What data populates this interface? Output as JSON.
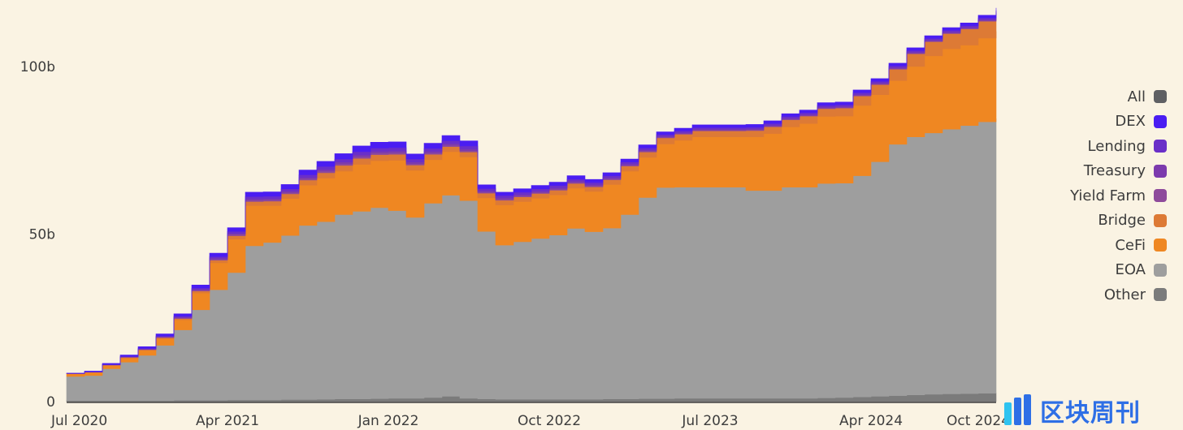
{
  "chart_data": {
    "type": "area",
    "stacked": true,
    "title": "",
    "xlabel": "",
    "ylabel": "",
    "ylim": [
      0,
      115
    ],
    "y_unit": "b",
    "y_ticks": [
      {
        "value": 0,
        "label": "0"
      },
      {
        "value": 50,
        "label": "50b"
      },
      {
        "value": 100,
        "label": "100b"
      }
    ],
    "x_ticks": [
      "Jul 2020",
      "Apr 2021",
      "Jan 2022",
      "Oct 2022",
      "Jul 2023",
      "Apr 2024",
      "Oct 2024"
    ],
    "x": [
      "2020-07",
      "2020-08",
      "2020-09",
      "2020-10",
      "2020-11",
      "2020-12",
      "2021-01",
      "2021-02",
      "2021-03",
      "2021-04",
      "2021-05",
      "2021-06",
      "2021-07",
      "2021-08",
      "2021-09",
      "2021-10",
      "2021-11",
      "2021-12",
      "2022-01",
      "2022-02",
      "2022-03",
      "2022-04",
      "2022-05",
      "2022-06",
      "2022-07",
      "2022-08",
      "2022-09",
      "2022-10",
      "2022-11",
      "2022-12",
      "2023-01",
      "2023-02",
      "2023-03",
      "2023-04",
      "2023-05",
      "2023-06",
      "2023-07",
      "2023-08",
      "2023-09",
      "2023-10",
      "2023-11",
      "2023-12",
      "2024-01",
      "2024-02",
      "2024-03",
      "2024-04",
      "2024-05",
      "2024-06",
      "2024-07",
      "2024-08",
      "2024-09",
      "2024-10",
      "2024-11"
    ],
    "legend_position": "right",
    "series": [
      {
        "name": "Other",
        "color": "#7b7b7b",
        "values": [
          0.3,
          0.3,
          0.3,
          0.3,
          0.3,
          0.3,
          0.4,
          0.4,
          0.4,
          0.5,
          0.5,
          0.5,
          0.6,
          0.6,
          0.7,
          0.8,
          0.8,
          0.9,
          1.0,
          1.0,
          1.2,
          1.6,
          1.0,
          0.8,
          0.7,
          0.7,
          0.7,
          0.7,
          0.7,
          0.7,
          0.8,
          0.8,
          0.9,
          0.9,
          1.0,
          1.0,
          1.0,
          1.0,
          1.0,
          1.0,
          1.0,
          1.0,
          1.1,
          1.2,
          1.4,
          1.6,
          1.8,
          2.0,
          2.2,
          2.3,
          2.4,
          2.5,
          2.5
        ]
      },
      {
        "name": "EOA",
        "color": "#9e9e9e",
        "values": [
          7.2,
          7.5,
          9.5,
          11.5,
          13.5,
          16.5,
          21,
          27,
          33,
          38,
          46,
          47,
          49,
          52,
          53,
          55,
          56,
          57,
          56,
          54,
          58,
          60,
          59,
          50,
          46,
          47,
          48,
          49,
          51,
          50,
          51,
          55,
          60,
          63,
          63,
          63,
          63,
          63,
          62,
          62,
          63,
          63,
          64,
          64,
          66,
          70,
          75,
          77,
          78,
          79,
          80,
          81,
          82
        ]
      },
      {
        "name": "CeFi",
        "color": "#ef8722",
        "values": [
          0.8,
          0.9,
          1.0,
          1.2,
          1.5,
          2.0,
          3,
          5,
          8,
          10,
          12,
          11,
          11,
          12,
          13,
          13,
          14,
          14,
          15,
          14,
          13,
          13,
          13,
          10,
          12,
          12,
          12,
          12,
          12,
          12,
          13,
          13,
          12,
          13,
          14,
          15,
          15,
          15,
          16,
          17,
          18,
          19,
          20,
          20,
          21,
          20,
          19,
          21,
          23,
          24,
          24,
          25,
          26
        ]
      },
      {
        "name": "Bridge",
        "color": "#dd7a35",
        "values": [
          0.1,
          0.1,
          0.1,
          0.2,
          0.2,
          0.3,
          0.4,
          0.6,
          0.8,
          1.0,
          1.2,
          1.3,
          1.4,
          1.5,
          1.6,
          1.7,
          1.8,
          1.8,
          1.8,
          1.6,
          1.6,
          1.5,
          1.5,
          1.4,
          1.4,
          1.4,
          1.4,
          1.4,
          1.4,
          1.4,
          1.4,
          1.5,
          1.6,
          1.8,
          1.8,
          1.8,
          1.8,
          1.8,
          1.9,
          2.0,
          2.1,
          2.2,
          2.3,
          2.4,
          2.8,
          3.0,
          3.4,
          3.8,
          4.2,
          4.5,
          4.8,
          5.0,
          5.2
        ]
      },
      {
        "name": "Yield Farm",
        "color": "#8e4a9b",
        "values": [
          0.0,
          0.0,
          0.1,
          0.1,
          0.1,
          0.2,
          0.2,
          0.3,
          0.3,
          0.4,
          0.4,
          0.4,
          0.4,
          0.4,
          0.5,
          0.5,
          0.5,
          0.5,
          0.5,
          0.4,
          0.4,
          0.4,
          0.4,
          0.3,
          0.3,
          0.3,
          0.3,
          0.3,
          0.3,
          0.3,
          0.3,
          0.3,
          0.3,
          0.2,
          0.2,
          0.2,
          0.2,
          0.2,
          0.2,
          0.2,
          0.2,
          0.2,
          0.2,
          0.2,
          0.2,
          0.2,
          0.2,
          0.2,
          0.2,
          0.2,
          0.2,
          0.2,
          0.2
        ]
      },
      {
        "name": "Treasury",
        "color": "#7c3aad",
        "values": [
          0.0,
          0.0,
          0.0,
          0.1,
          0.1,
          0.1,
          0.2,
          0.2,
          0.3,
          0.3,
          0.4,
          0.4,
          0.4,
          0.4,
          0.5,
          0.5,
          0.5,
          0.5,
          0.5,
          0.5,
          0.5,
          0.5,
          0.5,
          0.4,
          0.4,
          0.4,
          0.4,
          0.4,
          0.4,
          0.4,
          0.3,
          0.3,
          0.3,
          0.3,
          0.3,
          0.3,
          0.3,
          0.3,
          0.3,
          0.3,
          0.3,
          0.3,
          0.3,
          0.3,
          0.3,
          0.3,
          0.3,
          0.3,
          0.3,
          0.3,
          0.3,
          0.3,
          0.3
        ]
      },
      {
        "name": "Lending",
        "color": "#6a2fc8",
        "values": [
          0.0,
          0.1,
          0.1,
          0.1,
          0.2,
          0.2,
          0.3,
          0.4,
          0.5,
          0.6,
          0.7,
          0.7,
          0.7,
          0.8,
          0.9,
          0.9,
          1.0,
          1.0,
          1.0,
          0.9,
          0.9,
          0.9,
          0.9,
          0.7,
          0.7,
          0.7,
          0.7,
          0.7,
          0.6,
          0.6,
          0.6,
          0.6,
          0.6,
          0.5,
          0.5,
          0.5,
          0.5,
          0.5,
          0.5,
          0.5,
          0.5,
          0.5,
          0.5,
          0.5,
          0.5,
          0.5,
          0.5,
          0.5,
          0.5,
          0.5,
          0.5,
          0.5,
          0.5
        ]
      },
      {
        "name": "DEX",
        "color": "#4a1df2",
        "values": [
          0.1,
          0.2,
          0.3,
          0.4,
          0.5,
          0.6,
          0.7,
          0.9,
          1.0,
          1.1,
          1.3,
          1.3,
          1.3,
          1.4,
          1.5,
          1.6,
          1.7,
          1.7,
          1.7,
          1.5,
          1.5,
          1.5,
          1.5,
          1.1,
          1.0,
          1.0,
          1.0,
          1.0,
          1.0,
          0.9,
          0.9,
          0.9,
          0.9,
          0.8,
          0.8,
          0.8,
          0.8,
          0.8,
          0.8,
          0.8,
          0.8,
          0.8,
          0.8,
          0.8,
          0.8,
          0.8,
          0.8,
          0.8,
          0.8,
          0.8,
          0.8,
          0.8,
          0.8
        ]
      }
    ]
  },
  "legend": [
    {
      "label": "All",
      "color": "#5f6063"
    },
    {
      "label": "DEX",
      "color": "#4a1df2"
    },
    {
      "label": "Lending",
      "color": "#6a2fc8"
    },
    {
      "label": "Treasury",
      "color": "#7c3aad"
    },
    {
      "label": "Yield Farm",
      "color": "#8e4a9b"
    },
    {
      "label": "Bridge",
      "color": "#dd7a35"
    },
    {
      "label": "CeFi",
      "color": "#ef8722"
    },
    {
      "label": "EOA",
      "color": "#9e9e9e"
    },
    {
      "label": "Other",
      "color": "#7b7b7b"
    }
  ],
  "watermark": {
    "text": "区块周刊"
  }
}
